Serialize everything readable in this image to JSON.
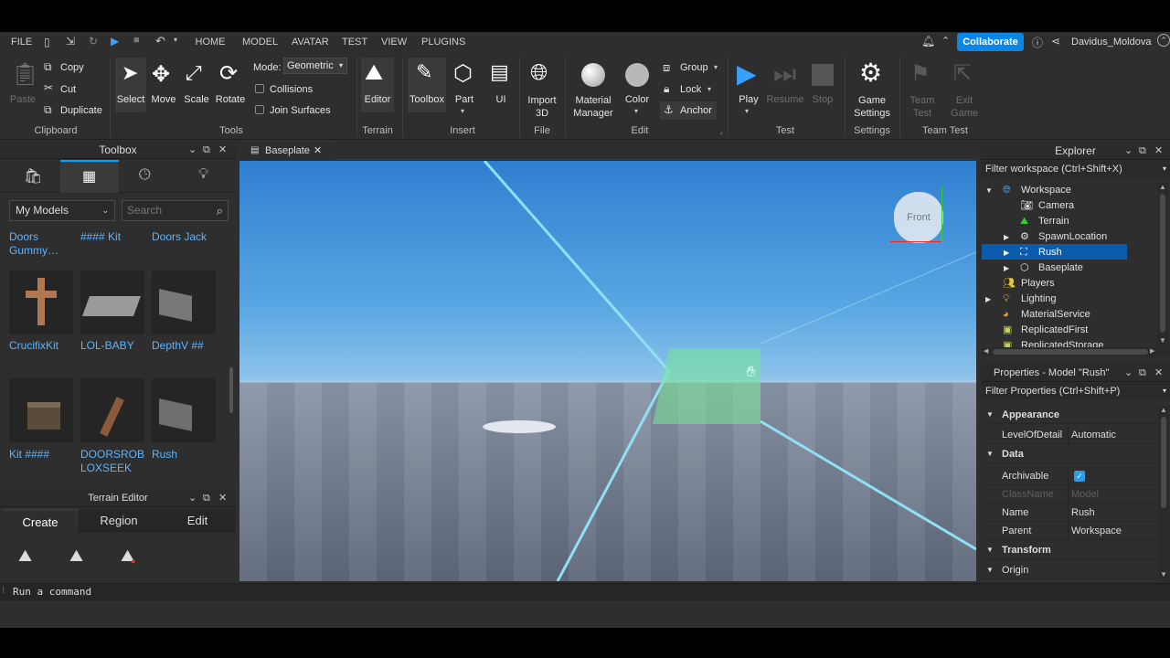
{
  "menu": {
    "file": "FILE",
    "tabs": [
      {
        "label": "HOME",
        "active": true
      },
      {
        "label": "MODEL"
      },
      {
        "label": "AVATAR"
      },
      {
        "label": "TEST"
      },
      {
        "label": "VIEW"
      },
      {
        "label": "PLUGINS"
      }
    ],
    "collaborate": "Collaborate",
    "username": "Davidus_Moldova"
  },
  "ribbon": {
    "clipboard": {
      "paste": "Paste",
      "copy": "Copy",
      "cut": "Cut",
      "duplicate": "Duplicate",
      "group": "Clipboard"
    },
    "tools": {
      "select": "Select",
      "move": "Move",
      "scale": "Scale",
      "rotate": "Rotate",
      "mode_label": "Mode:",
      "mode_value": "Geometric",
      "collisions": "Collisions",
      "join_surfaces": "Join Surfaces",
      "group": "Tools"
    },
    "terrain": {
      "editor": "Editor",
      "group": "Terrain"
    },
    "insert": {
      "toolbox": "Toolbox",
      "part": "Part",
      "ui": "UI",
      "group": "Insert"
    },
    "file": {
      "import3d_line1": "Import",
      "import3d_line2": "3D",
      "group": "File"
    },
    "edit": {
      "material_line1": "Material",
      "material_line2": "Manager",
      "color": "Color",
      "group_btn": "Group",
      "lock": "Lock",
      "anchor": "Anchor",
      "group": "Edit"
    },
    "test": {
      "play": "Play",
      "resume": "Resume",
      "stop": "Stop",
      "group": "Test"
    },
    "settings": {
      "game_line1": "Game",
      "game_line2": "Settings",
      "group": "Settings"
    },
    "teamtest": {
      "team_line1": "Team",
      "team_line2": "Test",
      "exit_line1": "Exit",
      "exit_line2": "Game",
      "group": "Team Test"
    }
  },
  "toolbox": {
    "title": "Toolbox",
    "category": "My Models",
    "search_placeholder": "Search",
    "top_labels": [
      "Doors Gummy…",
      "#### Kit",
      "Doors Jack"
    ],
    "items_row1": [
      "CrucifixKit",
      "LOL-BABY",
      "DepthV ##"
    ],
    "items_row2": [
      "Kit ####",
      "DOORSROBLOXSEEK",
      "Rush"
    ]
  },
  "terrain_editor": {
    "title": "Terrain Editor",
    "tabs": [
      "Create",
      "Region",
      "Edit"
    ]
  },
  "viewport": {
    "tab": "Baseplate",
    "view_cube": "Front"
  },
  "explorer": {
    "title": "Explorer",
    "filter": "Filter workspace (Ctrl+Shift+X)",
    "items": [
      "Workspace",
      "Camera",
      "Terrain",
      "SpawnLocation",
      "Rush",
      "Baseplate",
      "Players",
      "Lighting",
      "MaterialService",
      "ReplicatedFirst",
      "ReplicatedStorage"
    ]
  },
  "properties": {
    "title": "Properties - Model \"Rush\"",
    "filter": "Filter Properties (Ctrl+Shift+P)",
    "appearance": "Appearance",
    "lod_label": "LevelOfDetail",
    "lod_value": "Automatic",
    "data": "Data",
    "archivable": "Archivable",
    "classname_label": "ClassName",
    "classname_value": "Model",
    "name_label": "Name",
    "name_value": "Rush",
    "parent_label": "Parent",
    "parent_value": "Workspace",
    "transform": "Transform",
    "origin": "Origin"
  },
  "command_bar": {
    "placeholder": "Run a command"
  },
  "colors": {
    "accent": "#00a2ff",
    "selection": "#0b5cad",
    "link": "#5eb4ff"
  }
}
